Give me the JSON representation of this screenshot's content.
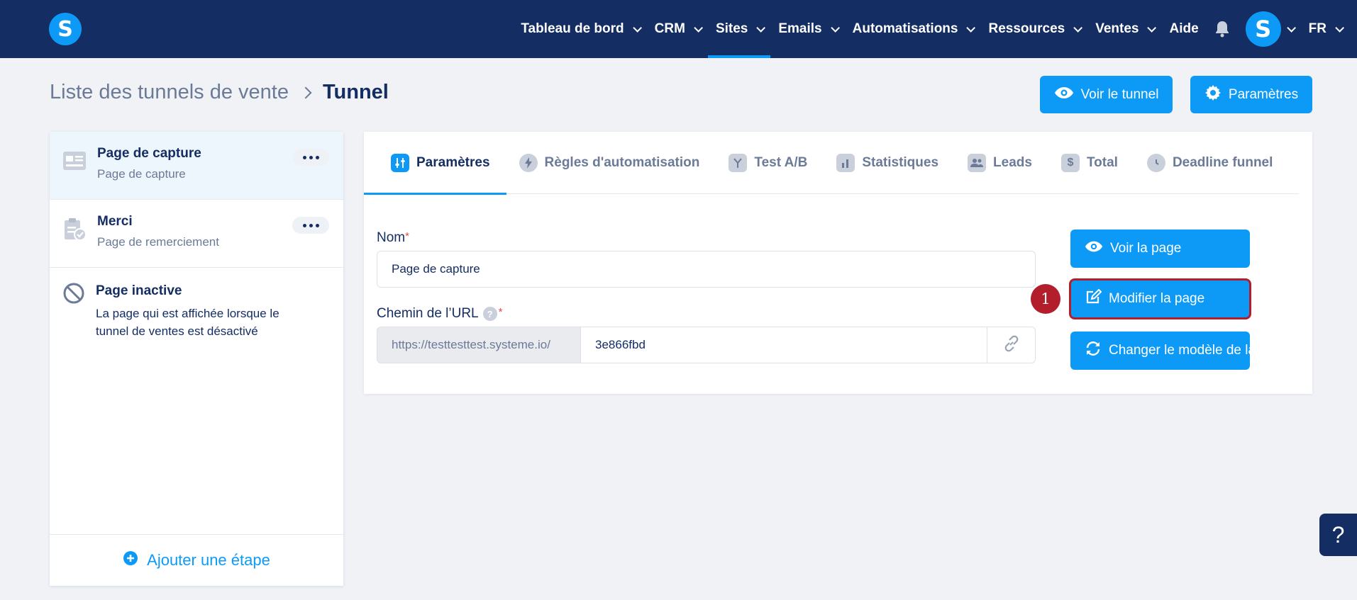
{
  "brand": {
    "logo_letter": "S",
    "accent": "#0d9af7",
    "nav_bg": "#142d63",
    "highlight": "#b31e2c"
  },
  "nav": {
    "items": [
      {
        "label": "Tableau de bord",
        "has_chevron": true
      },
      {
        "label": "CRM",
        "has_chevron": true
      },
      {
        "label": "Sites",
        "has_chevron": true,
        "active": true
      },
      {
        "label": "Emails",
        "has_chevron": true
      },
      {
        "label": "Automatisations",
        "has_chevron": true
      },
      {
        "label": "Ressources",
        "has_chevron": true
      },
      {
        "label": "Ventes",
        "has_chevron": true
      },
      {
        "label": "Aide",
        "has_chevron": false
      }
    ],
    "avatar_letter": "S",
    "language": "FR"
  },
  "breadcrumb": {
    "parent": "Liste des tunnels de vente",
    "current": "Tunnel"
  },
  "header_buttons": {
    "view_funnel": "Voir le tunnel",
    "settings": "Paramètres"
  },
  "steps": [
    {
      "title": "Page de capture",
      "subtitle": "Page de capture",
      "icon": "capture-page-icon"
    },
    {
      "title": "Merci",
      "subtitle": "Page de remerciement",
      "icon": "thank-you-page-icon"
    }
  ],
  "inactive_page": {
    "title": "Page inactive",
    "description": "La page qui est affichée lorsque le tunnel de ventes est désactivé"
  },
  "add_step_label": "Ajouter une étape",
  "tabs": [
    {
      "label": "Paramètres",
      "icon": "sliders-icon"
    },
    {
      "label": "Règles d'automatisation",
      "icon": "bolt-icon"
    },
    {
      "label": "Test A/B",
      "icon": "split-icon"
    },
    {
      "label": "Statistiques",
      "icon": "bar-chart-icon"
    },
    {
      "label": "Leads",
      "icon": "users-icon"
    },
    {
      "label": "Total",
      "icon": "dollar-icon"
    },
    {
      "label": "Deadline funnel",
      "icon": "clock-icon"
    }
  ],
  "form": {
    "name_label": "Nom",
    "name_value": "Page de capture",
    "required_mark": "*",
    "url_label": "Chemin de l’URL",
    "url_prefix": "https://testtesttest.systeme.io/",
    "url_path": "3e866fbd",
    "help_mark": "?"
  },
  "page_actions": {
    "view": "Voir la page",
    "edit": "Modifier la page",
    "change_template": "Changer le modèle de la page"
  },
  "annotation_number": "1",
  "help_float": "?"
}
